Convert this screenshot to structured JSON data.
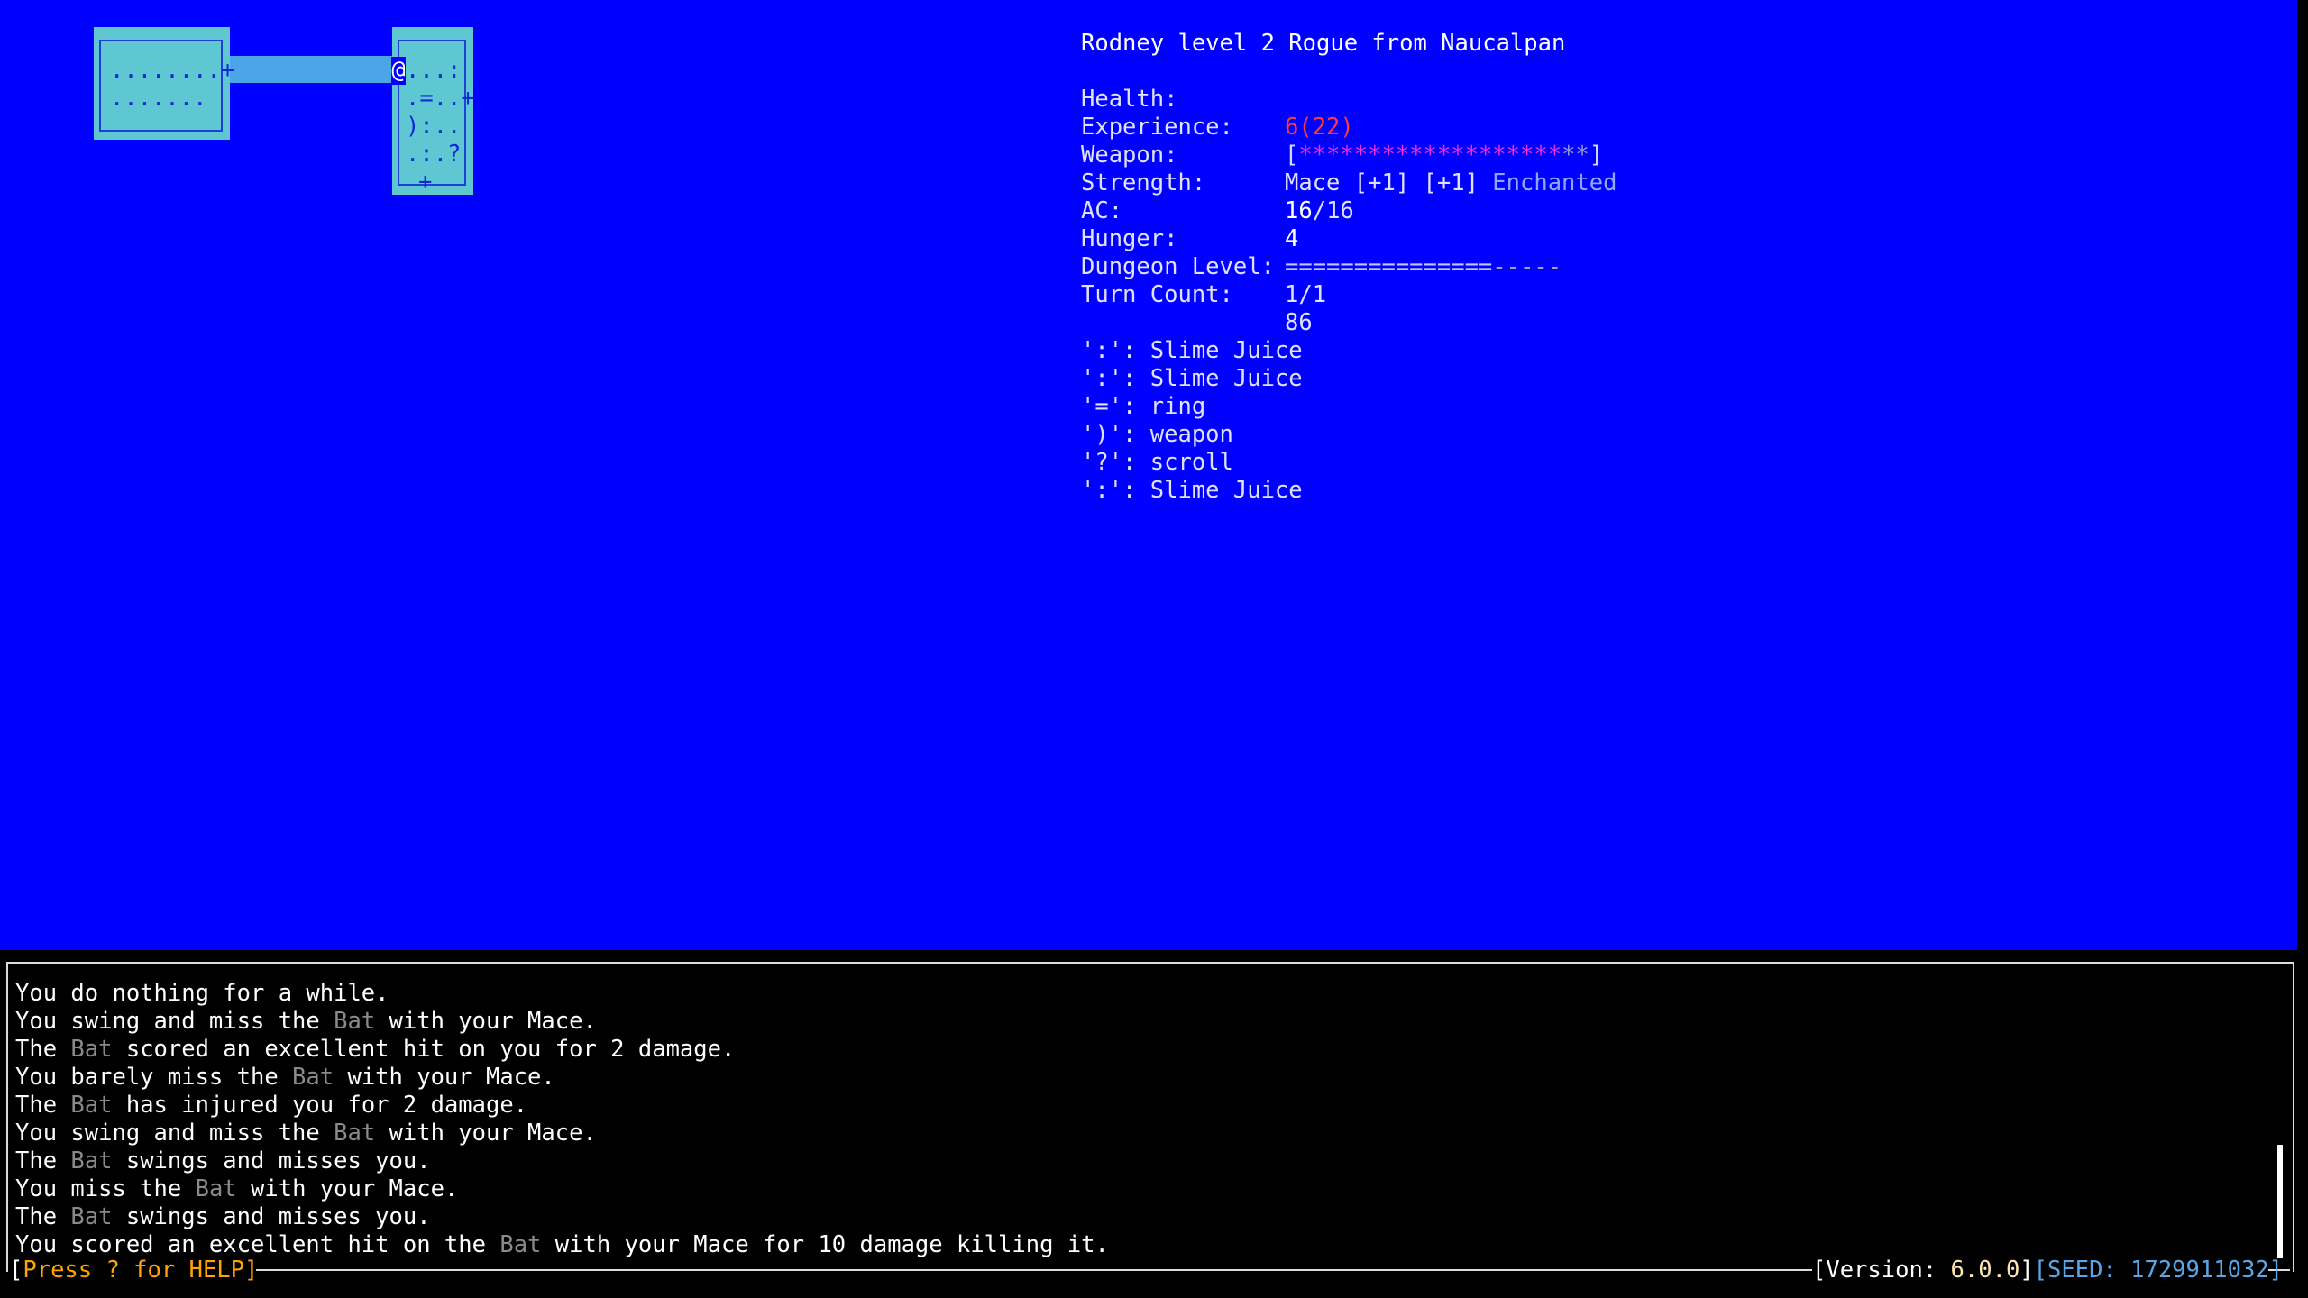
{
  "header": {
    "title": "Rodney level 2 Rogue from Naucalpan"
  },
  "stats": [
    {
      "label": "Health:",
      "value": "6(22)",
      "color": "#ff3838"
    },
    {
      "label": "Experience:",
      "value_open": "[",
      "value_fill": "*******************",
      "value_empty": "**",
      "value_close": "]"
    },
    {
      "label": "Weapon:",
      "value": "Mace [+1] [+1]",
      "value_extra": "Enchanted"
    },
    {
      "label": "Strength:",
      "value_cur": "16",
      "value_max": "/16"
    },
    {
      "label": "AC:",
      "value": "4"
    },
    {
      "label": "Hunger:",
      "value_fill": "===============",
      "value_empty": "-----"
    },
    {
      "label": "Dungeon Level:",
      "value": "1/1"
    },
    {
      "label": "Turn Count:",
      "value": "86"
    }
  ],
  "experience_progress": 0.9,
  "hunger_progress": 0.75,
  "inventory": [
    "':': Slime Juice",
    "':': Slime Juice",
    "'=': ring",
    "')': weapon",
    "'?': scroll",
    "':': Slime Juice"
  ],
  "map": {
    "room1_row1": "........+",
    "room1_row2": ".......",
    "room2_player": "@",
    "room2_row1": "...:",
    "room2_row2": ".=..+",
    "room2_row3": "):..",
    "room2_row4": ".:.?",
    "room2_row5": "+"
  },
  "log": [
    [
      {
        "t": "You do nothing for a while."
      }
    ],
    [
      {
        "t": "You swing and miss the "
      },
      {
        "t": "Bat",
        "m": true
      },
      {
        "t": " with your Mace."
      }
    ],
    [
      {
        "t": "The "
      },
      {
        "t": "Bat",
        "m": true
      },
      {
        "t": " scored an excellent hit on you for 2 damage."
      }
    ],
    [
      {
        "t": "You barely miss the "
      },
      {
        "t": "Bat",
        "m": true
      },
      {
        "t": " with your Mace."
      }
    ],
    [
      {
        "t": "The "
      },
      {
        "t": "Bat",
        "m": true
      },
      {
        "t": " has injured you for 2 damage."
      }
    ],
    [
      {
        "t": "You swing and miss the "
      },
      {
        "t": "Bat",
        "m": true
      },
      {
        "t": " with your Mace."
      }
    ],
    [
      {
        "t": "The "
      },
      {
        "t": "Bat",
        "m": true
      },
      {
        "t": " swings and misses you."
      }
    ],
    [
      {
        "t": "You miss the "
      },
      {
        "t": "Bat",
        "m": true
      },
      {
        "t": " with your Mace."
      }
    ],
    [
      {
        "t": "The "
      },
      {
        "t": "Bat",
        "m": true
      },
      {
        "t": " swings and misses you."
      }
    ],
    [
      {
        "t": "You scored an excellent hit on the "
      },
      {
        "t": "Bat",
        "m": true
      },
      {
        "t": " with your Mace for 10 damage killing it."
      }
    ]
  ],
  "footer": {
    "help_open": "[",
    "help": "Press ? for HELP",
    "help_close": "]",
    "version_label": "[Version: ",
    "version": "6.0.0",
    "version_close": "]",
    "seed": "[SEED: 1729911032]",
    "seed_close": ""
  },
  "colors": {
    "background": "#0000ff",
    "room": "#5fc7d2",
    "corridor": "#4aa6e6",
    "health": "#ff3838",
    "experience": "#ff2bd6",
    "help": "#ffa500",
    "seed": "#5aa6e6"
  }
}
